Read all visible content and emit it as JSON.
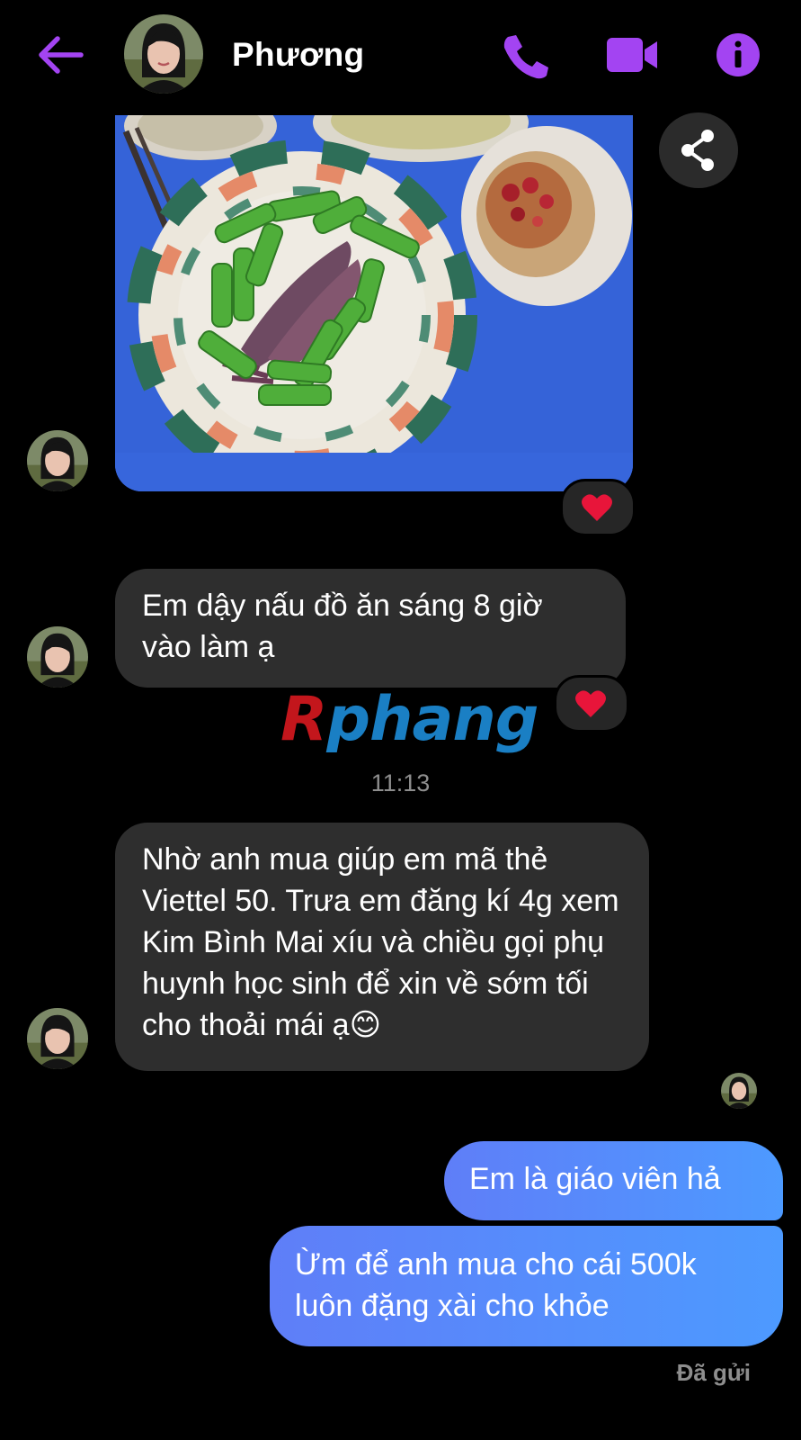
{
  "header": {
    "contact_name": "Phương"
  },
  "messages": {
    "msg1": "Em dậy nấu đồ ăn sáng 8 giờ vào làm ạ",
    "msg2": "Nhờ anh mua giúp em mã thẻ Viettel 50. Trưa em đăng kí 4g xem Kim Bình Mai xíu và chiều gọi phụ huynh học sinh để xin về sớm tối cho thoải mái ạ😊",
    "msg3": "Em là giáo viên hả",
    "msg4": "Ừm để anh mua cho cái 500k luôn đặng xài cho khỏe"
  },
  "timestamp": "11:13",
  "watermark": {
    "first_letter": "R",
    "rest": "phang"
  },
  "status": "Đã gửi",
  "colors": {
    "accent": "#a344f2",
    "outgoing_start": "#5f7ef8",
    "outgoing_end": "#4d9aff",
    "incoming_bubble": "#2e2e2e",
    "reaction_heart": "#e8153a"
  },
  "icons": {
    "back": "back-arrow-icon",
    "call": "phone-icon",
    "video": "video-camera-icon",
    "info": "info-icon",
    "share": "share-icon",
    "reaction": "heart-icon"
  }
}
